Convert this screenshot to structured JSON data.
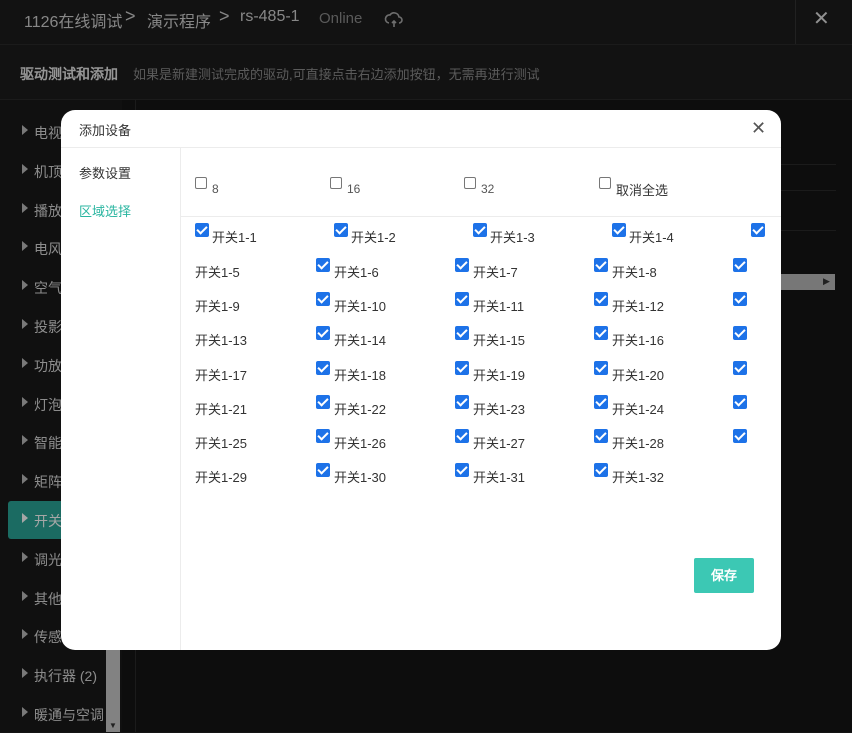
{
  "header": {
    "breadcrumb": [
      "1126在线调试",
      "演示程序",
      "rs-485-1"
    ],
    "status": "Online",
    "close_symbol": "✕"
  },
  "subheader": {
    "title": "驱动测试和添加",
    "hint": "如果是新建测试完成的驱动,可直接点击右边添加按钮，无需再进行测试"
  },
  "sidebar": {
    "items": [
      {
        "label": "电视"
      },
      {
        "label": "机顶"
      },
      {
        "label": "播放"
      },
      {
        "label": "电风"
      },
      {
        "label": "空气"
      },
      {
        "label": "投影"
      },
      {
        "label": "功放"
      },
      {
        "label": "灯泡"
      },
      {
        "label": "智能"
      },
      {
        "label": "矩阵"
      },
      {
        "label": "开关"
      },
      {
        "label": "调光"
      },
      {
        "label": "其他"
      },
      {
        "label": "传感"
      },
      {
        "label": "执行器 (2)"
      },
      {
        "label": "暖通与空调"
      }
    ],
    "active_index": 10
  },
  "modal": {
    "title": "添加设备",
    "close_symbol": "✕",
    "tabs": [
      {
        "label": "参数设置",
        "active": false
      },
      {
        "label": "区域选择",
        "active": true
      }
    ],
    "options": [
      {
        "label": "8",
        "checked": false
      },
      {
        "label": "16",
        "checked": false
      },
      {
        "label": "32",
        "checked": false
      },
      {
        "label": "取消全选",
        "checked": false
      }
    ],
    "switches": [
      {
        "label": "开关1-1",
        "checked": true
      },
      {
        "label": "开关1-2",
        "checked": true
      },
      {
        "label": "开关1-3",
        "checked": true
      },
      {
        "label": "开关1-4",
        "checked": true
      },
      {
        "label": "开关1-5",
        "checked": true
      },
      {
        "label": "开关1-6",
        "checked": true
      },
      {
        "label": "开关1-7",
        "checked": true
      },
      {
        "label": "开关1-8",
        "checked": true
      },
      {
        "label": "开关1-9",
        "checked": true
      },
      {
        "label": "开关1-10",
        "checked": true
      },
      {
        "label": "开关1-11",
        "checked": true
      },
      {
        "label": "开关1-12",
        "checked": true
      },
      {
        "label": "开关1-13",
        "checked": true
      },
      {
        "label": "开关1-14",
        "checked": true
      },
      {
        "label": "开关1-15",
        "checked": true
      },
      {
        "label": "开关1-16",
        "checked": true
      },
      {
        "label": "开关1-17",
        "checked": true
      },
      {
        "label": "开关1-18",
        "checked": true
      },
      {
        "label": "开关1-19",
        "checked": true
      },
      {
        "label": "开关1-20",
        "checked": true
      },
      {
        "label": "开关1-21",
        "checked": true
      },
      {
        "label": "开关1-22",
        "checked": true
      },
      {
        "label": "开关1-23",
        "checked": true
      },
      {
        "label": "开关1-24",
        "checked": true
      },
      {
        "label": "开关1-25",
        "checked": true
      },
      {
        "label": "开关1-26",
        "checked": true
      },
      {
        "label": "开关1-27",
        "checked": true
      },
      {
        "label": "开关1-28",
        "checked": true
      },
      {
        "label": "开关1-29",
        "checked": true
      },
      {
        "label": "开关1-30",
        "checked": true
      },
      {
        "label": "开关1-31",
        "checked": true
      },
      {
        "label": "开关1-32",
        "checked": true
      }
    ],
    "save_label": "保存"
  },
  "colors": {
    "accent": "#2aa597",
    "save_button": "#3cc8b4",
    "checkbox": "#1d72e8",
    "active_tab": "#29b5a0"
  },
  "icons": [
    "cloud-sync-icon",
    "close-icon",
    "caret-right-icon"
  ]
}
